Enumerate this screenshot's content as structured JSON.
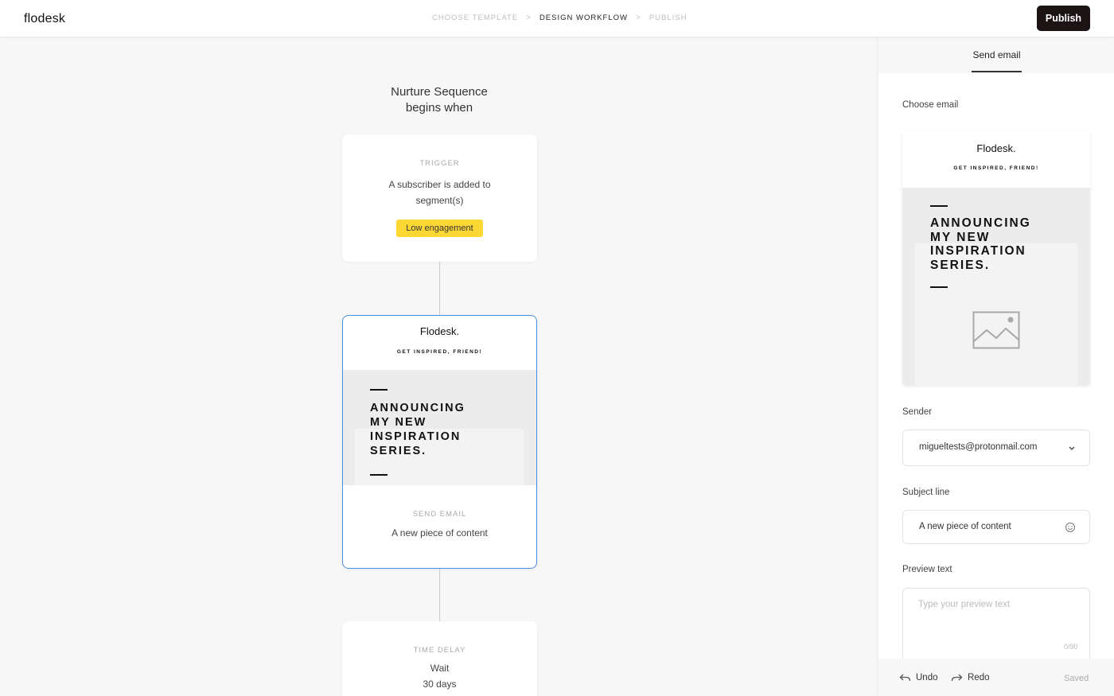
{
  "header": {
    "logo": "flodesk",
    "steps": [
      {
        "label": "CHOOSE TEMPLATE",
        "active": false
      },
      {
        "label": "DESIGN WORKFLOW",
        "active": true
      },
      {
        "label": "PUBLISH",
        "active": false
      }
    ],
    "step_separator": ">",
    "publish_label": "Publish"
  },
  "canvas": {
    "title_line1": "Nurture Sequence",
    "title_line2": "begins when",
    "trigger": {
      "label": "TRIGGER",
      "text_line1": "A subscriber is added to",
      "text_line2": "segment(s)",
      "badge": "Low engagement",
      "badge_color": "#fdd835"
    },
    "email_step": {
      "thumb_brand": "Flodesk.",
      "thumb_tagline": "GET INSPIRED, FRIEND!",
      "thumb_headline": "ANNOUNCING\nMY NEW\nINSPIRATION\nSERIES.",
      "label": "SEND EMAIL",
      "subject": "A new piece of content",
      "selected_color": "#4a90e2"
    },
    "delay_step": {
      "label": "TIME DELAY",
      "text_line1": "Wait",
      "text_line2": "30 days"
    }
  },
  "panel": {
    "tab": "Send email",
    "choose_email_label": "Choose email",
    "preview": {
      "brand": "Flodesk.",
      "tagline": "GET INSPIRED, FRIEND!",
      "headline": "ANNOUNCING\nMY NEW\nINSPIRATION\nSERIES."
    },
    "sender_label": "Sender",
    "sender_value": "migueltests@protonmail.com",
    "subject_label": "Subject line",
    "subject_value": "A new piece of content",
    "preview_text_label": "Preview text",
    "preview_text_placeholder": "Type your preview text",
    "preview_text_counter": "0/90",
    "undo_label": "Undo",
    "redo_label": "Redo",
    "saved_label": "Saved"
  }
}
